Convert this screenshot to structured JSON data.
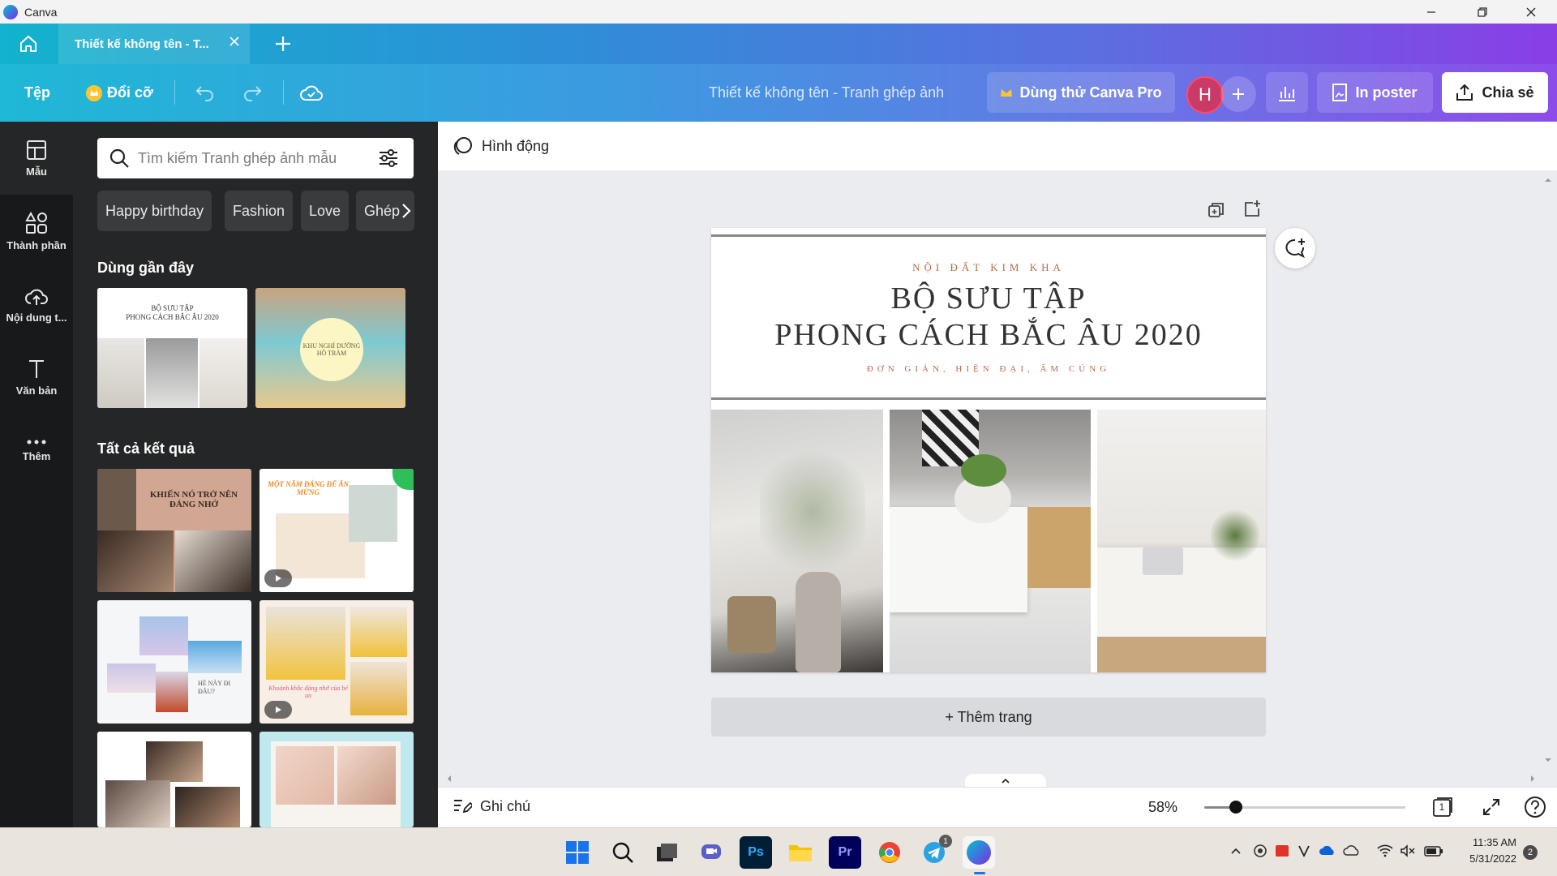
{
  "window": {
    "title": "Canva"
  },
  "tabs": {
    "active_label": "Thiết kế không tên - T..."
  },
  "toolbar": {
    "file_label": "Tệp",
    "resize_label": "Đổi cỡ",
    "doc_title": "Thiết kế không tên - Tranh ghép ảnh",
    "pro_label": "Dùng thử Canva Pro",
    "avatar_initial": "H",
    "print_label": "In poster",
    "share_label": "Chia sẻ"
  },
  "rail": {
    "items": [
      {
        "label": "Mẫu",
        "icon": "template-icon"
      },
      {
        "label": "Thành phần",
        "icon": "elements-icon"
      },
      {
        "label": "Nội dung t...",
        "icon": "upload-icon"
      },
      {
        "label": "Văn bản",
        "icon": "text-icon"
      },
      {
        "label": "Thêm",
        "icon": "more-icon"
      }
    ]
  },
  "panel": {
    "search_placeholder": "Tìm kiếm Tranh ghép ảnh mẫu",
    "chips": [
      "Happy birthday",
      "Fashion",
      "Love",
      "Ghép"
    ],
    "recent_title": "Dùng gần đây",
    "results_title": "Tất cả kết quả",
    "recent_thumbs": [
      {
        "heading": "BỘ SƯU TẬP\nPHONG CÁCH BẮC ÂU 2020"
      },
      {
        "heading": "KHU NGHỈ DƯỠNG\nHỒ TRÀM"
      }
    ],
    "result_thumbs": [
      {
        "heading": "KHIẾN NÓ TRỞ NÊN ĐÁNG NHỚ"
      },
      {
        "heading": "MỘT NĂM ĐÁNG ĐỂ ĂN MỪNG"
      },
      {
        "heading": "HÈ NÀY ĐI ĐÂU?"
      },
      {
        "heading": "Khoảnh khắc đáng nhớ của bé an"
      }
    ]
  },
  "subbar": {
    "animate_label": "Hình động"
  },
  "design": {
    "brand": "NỘI ĐẤT KIM KHA",
    "title_line1": "BỘ SƯU TẬP",
    "title_line2": "PHONG CÁCH BẮC ÂU 2020",
    "tagline": "ĐƠN GIẢN, HIỆN ĐẠI, ẤM CÚNG"
  },
  "canvas": {
    "add_page_label": "+ Thêm trang"
  },
  "bottombar": {
    "notes_label": "Ghi chú",
    "zoom": "58%",
    "zoom_level": 0.58,
    "page_count": "1"
  },
  "taskbar": {
    "time": "11:35 AM",
    "date": "5/31/2022",
    "notification_count": "2",
    "telegram_badge": "1"
  },
  "colors": {
    "accent": "#7d2ae8",
    "teal": "#00c4cc",
    "panel": "#252627",
    "rail": "#18191b"
  }
}
